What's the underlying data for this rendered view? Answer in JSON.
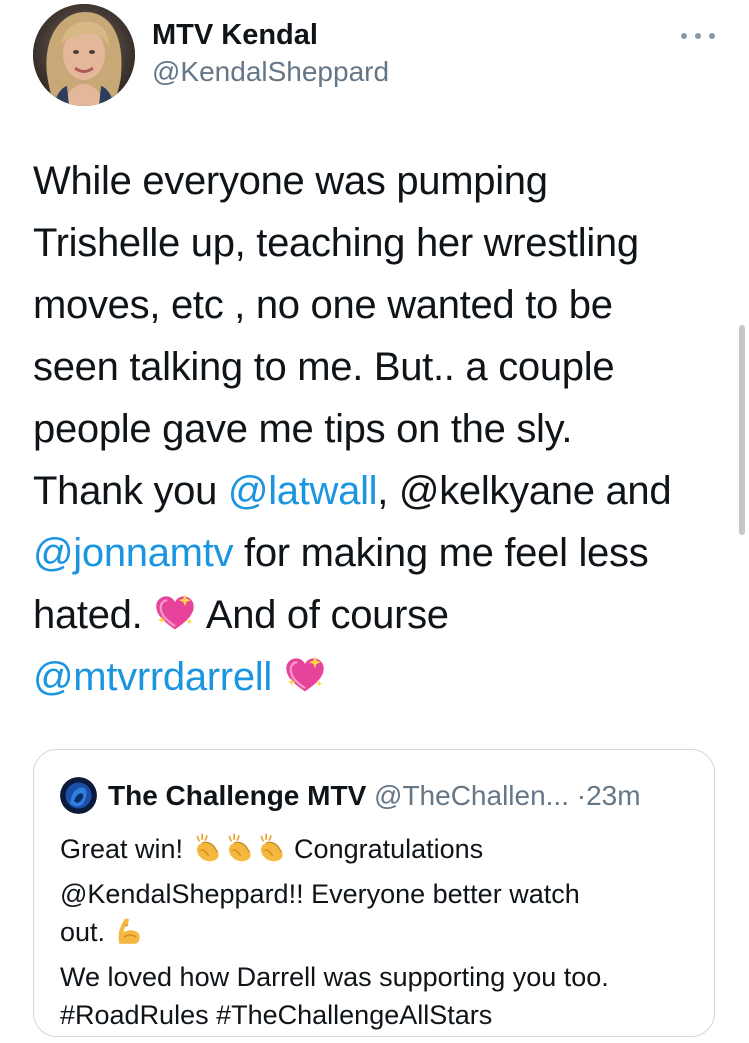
{
  "author": {
    "display_name": "MTV Kendal",
    "handle": "@KendalSheppard"
  },
  "tweet": {
    "lines": [
      [
        {
          "t": "While everyone was pumping"
        }
      ],
      [
        {
          "t": "Trishelle up, teaching her wrestling"
        }
      ],
      [
        {
          "t": "moves, etc , no one wanted to be"
        }
      ],
      [
        {
          "t": "seen talking to me. But.. a couple"
        }
      ],
      [
        {
          "t": "people gave me tips on the sly."
        }
      ],
      [
        {
          "t": "Thank you "
        },
        {
          "t": "@latwall",
          "link": true
        },
        {
          "t": ", @kelkyane and"
        }
      ],
      [
        {
          "t": "@jonnamtv",
          "link": true
        },
        {
          "t": " for making me feel less"
        }
      ],
      [
        {
          "t": "hated. "
        },
        {
          "emoji": "sparkling-heart"
        },
        {
          "t": " And of course"
        }
      ],
      [
        {
          "t": "@mtvrrdarrell",
          "link": true
        },
        {
          "t": " "
        },
        {
          "emoji": "sparkling-heart"
        }
      ]
    ]
  },
  "quoted_tweet": {
    "display_name": "The Challenge MTV",
    "handle": "@TheChallen...",
    "separator": "·",
    "time": "23m",
    "lines": [
      [
        {
          "t": "Great win! "
        },
        {
          "emoji": "clapping-hands"
        },
        {
          "emoji": "clapping-hands"
        },
        {
          "emoji": "clapping-hands"
        },
        {
          "t": " Congratulations"
        }
      ],
      [
        {
          "t": "@KendalSheppard!! Everyone better watch"
        }
      ],
      [
        {
          "t": "out. "
        },
        {
          "emoji": "flexed-biceps"
        }
      ],
      [
        {
          "t": "We loved how Darrell was supporting you too."
        }
      ],
      [
        {
          "t": "#RoadRules #TheChallengeAllStars"
        }
      ]
    ]
  },
  "colors": {
    "link": "#1b95e0",
    "text": "#0f1419",
    "secondary": "#657786",
    "border": "#cfd9de"
  }
}
